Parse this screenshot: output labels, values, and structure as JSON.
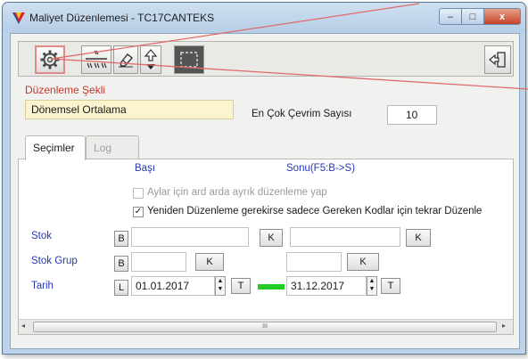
{
  "window": {
    "title": "Maliyet Düzenlemesi - TC17CANTEKS",
    "controls": {
      "min": "–",
      "max": "□",
      "close": "x"
    }
  },
  "toolbar": {
    "buttons": [
      {
        "name": "settings",
        "icon": "gear-icon"
      },
      {
        "name": "scheme",
        "icon": "scheme-icon"
      },
      {
        "name": "erase",
        "icon": "eraser-icon"
      },
      {
        "name": "arrows",
        "icon": "up-arrow-icon"
      },
      {
        "name": "select",
        "icon": "selection-icon"
      },
      {
        "name": "exit",
        "icon": "exit-icon"
      }
    ]
  },
  "form": {
    "method_label": "Düzenleme Şekli",
    "method_value": "Dönemsel Ortalama",
    "max_cycle_label": "En Çok Çevrim Sayısı",
    "max_cycle_value": "10"
  },
  "tabs": [
    {
      "label": "Seçimler",
      "active": true
    },
    {
      "label": "Log",
      "active": false
    }
  ],
  "panel": {
    "start_header": "Başı",
    "end_header": "Sonu(F5:B->S)",
    "check_monthly": {
      "label": "Aylar için ard arda ayrık düzenleme yap",
      "checked": false,
      "enabled": false
    },
    "check_reprocess": {
      "label": "Yeniden Düzenleme gerekirse sadece Gereken Kodlar için tekrar Düzenle",
      "checked": true,
      "enabled": true
    },
    "rows": {
      "stok": {
        "label": "Stok",
        "b": "B",
        "k1": "K",
        "k2": "K",
        "start": "",
        "end": ""
      },
      "stok_grup": {
        "label": "Stok Grup",
        "b": "B",
        "k1": "K",
        "k2": "K",
        "start": "",
        "end": ""
      },
      "tarih": {
        "label": "Tarih",
        "l": "L",
        "start": "01.01.2017",
        "end": "31.12.2017",
        "t1": "T",
        "t2": "T"
      }
    },
    "scroll": {
      "left": "◂",
      "right": "▸",
      "thumb": "III"
    }
  },
  "colors": {
    "label_red": "#c0392b",
    "label_blue": "#2637b5",
    "method_bg": "#fbf4cf",
    "date_bar": "#22cc22",
    "annotation": "#e06a6a"
  }
}
